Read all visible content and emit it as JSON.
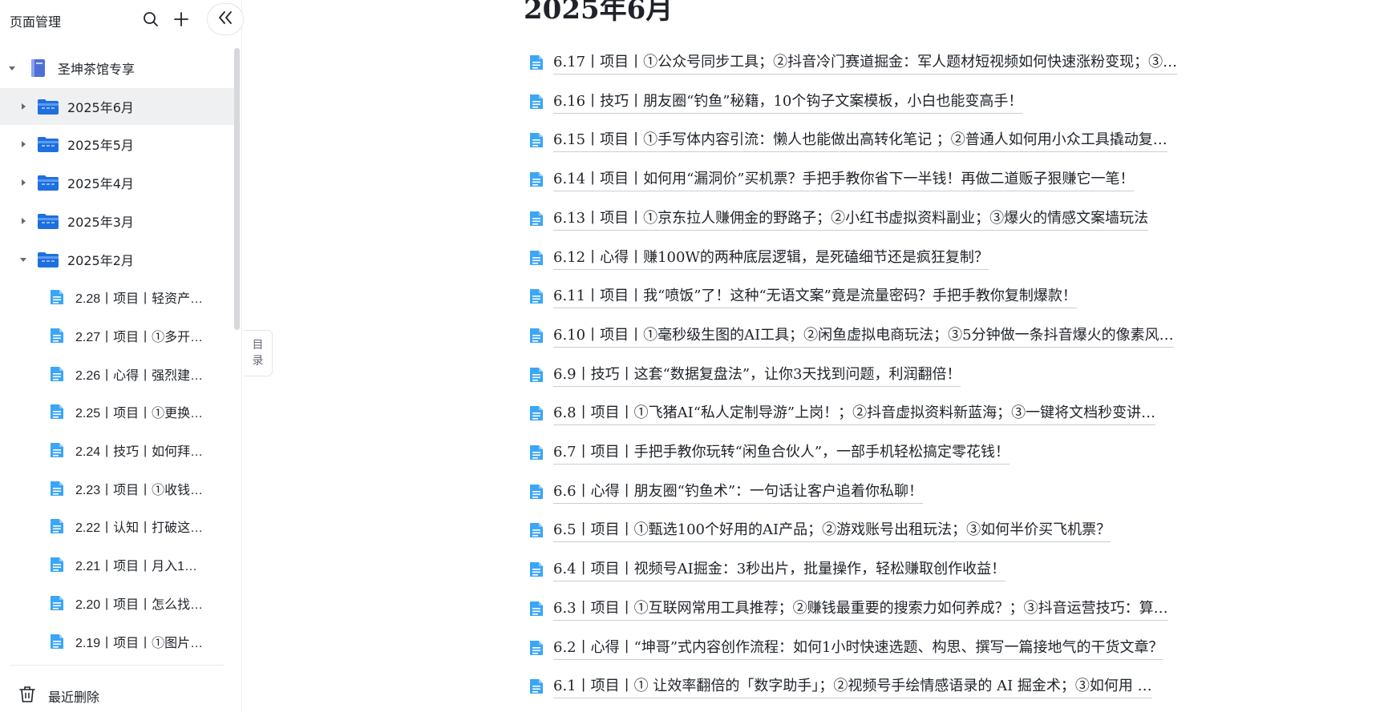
{
  "sidebar": {
    "title": "页面管理",
    "toc_tab": [
      "目",
      "录"
    ],
    "recent_label": "最近删除",
    "tree": [
      {
        "label": "圣坤茶馆专享",
        "type": "book",
        "arrow": "down"
      },
      {
        "label": "2025年6月",
        "type": "folder",
        "arrow": "right",
        "active": true
      },
      {
        "label": "2025年5月",
        "type": "folder",
        "arrow": "right"
      },
      {
        "label": "2025年4月",
        "type": "folder",
        "arrow": "right"
      },
      {
        "label": "2025年3月",
        "type": "folder",
        "arrow": "right"
      },
      {
        "label": "2025年2月",
        "type": "folder",
        "arrow": "down"
      },
      {
        "label": "2.28丨项目丨轻资产…",
        "type": "doc"
      },
      {
        "label": "2.27丨项目丨①多开…",
        "type": "doc"
      },
      {
        "label": "2.26丨心得丨强烈建…",
        "type": "doc"
      },
      {
        "label": "2.25丨项目丨①更换…",
        "type": "doc"
      },
      {
        "label": "2.24丨技巧丨如何拜…",
        "type": "doc"
      },
      {
        "label": "2.23丨项目丨①收钱…",
        "type": "doc"
      },
      {
        "label": "2.22丨认知丨打破这…",
        "type": "doc"
      },
      {
        "label": "2.21丨项目丨月入1…",
        "type": "doc"
      },
      {
        "label": "2.20丨项目丨怎么找…",
        "type": "doc"
      },
      {
        "label": "2.19丨项目丨①图片…",
        "type": "doc"
      }
    ]
  },
  "main": {
    "title": "2025年6月",
    "links": [
      "6.17丨项目丨①公众号同步工具；②抖音冷门赛道掘金：军人题材短视频如何快速涨粉变现；③…",
      "6.16丨技巧丨朋友圈“钓鱼”秘籍，10个钩子文案模板，小白也能变高手！",
      "6.15丨项目丨①手写体内容引流：懒人也能做出高转化笔记 ；②普通人如何用小众工具撬动复…",
      "6.14丨项目丨如何用“漏洞价”买机票？手把手教你省下一半钱！再做二道贩子狠赚它一笔！",
      "6.13丨项目丨①京东拉人赚佣金的野路子；②小红书虚拟资料副业；③爆火的情感文案墙玩法",
      "6.12丨心得丨赚100W的两种底层逻辑，是死磕细节还是疯狂复制？",
      "6.11丨项目丨我“喷饭”了！这种“无语文案”竟是流量密码？手把手教你复制爆款！",
      "6.10丨项目丨①毫秒级生图的AI工具；②闲鱼虚拟电商玩法；③5分钟做一条抖音爆火的像素风…",
      "6.9丨技巧丨这套“数据复盘法”，让你3天找到问题，利润翻倍！",
      "6.8丨项目丨①飞猪AI“私人定制导游”上岗！；②抖音虚拟资料新蓝海；③一键将文档秒变讲…",
      "6.7丨项目丨手把手教你玩转“闲鱼合伙人”，一部手机轻松搞定零花钱！",
      "6.6丨心得丨朋友圈“钓鱼术”：一句话让客户追着你私聊！",
      "6.5丨项目丨①甄选100个好用的AI产品；②游戏账号出租玩法；③如何半价买飞机票？",
      "6.4丨项目丨视频号AI掘金：3秒出片，批量操作，轻松赚取创作收益！",
      "6.3丨项目丨①互联网常用工具推荐；②赚钱最重要的搜索力如何养成？；③抖音运营技巧：算…",
      "6.2丨心得丨“坤哥”式内容创作流程：如何1小时快速选题、构思、撰写一篇接地气的干货文章？",
      "6.1丨项目丨① 让效率翻倍的「数字助手」；②视频号手绘情感语录的 AI 掘金术；③如何用 …"
    ]
  },
  "colors": {
    "doc_icon": "#3ba6f5",
    "folder_icon": "#1e6fe0",
    "book_icon": "#4e6fd6",
    "active_row": "#eff0f1"
  },
  "icons": [
    "search-icon",
    "plus-icon",
    "collapse-icon",
    "book-icon",
    "folder-icon",
    "doc-icon",
    "trash-icon"
  ]
}
